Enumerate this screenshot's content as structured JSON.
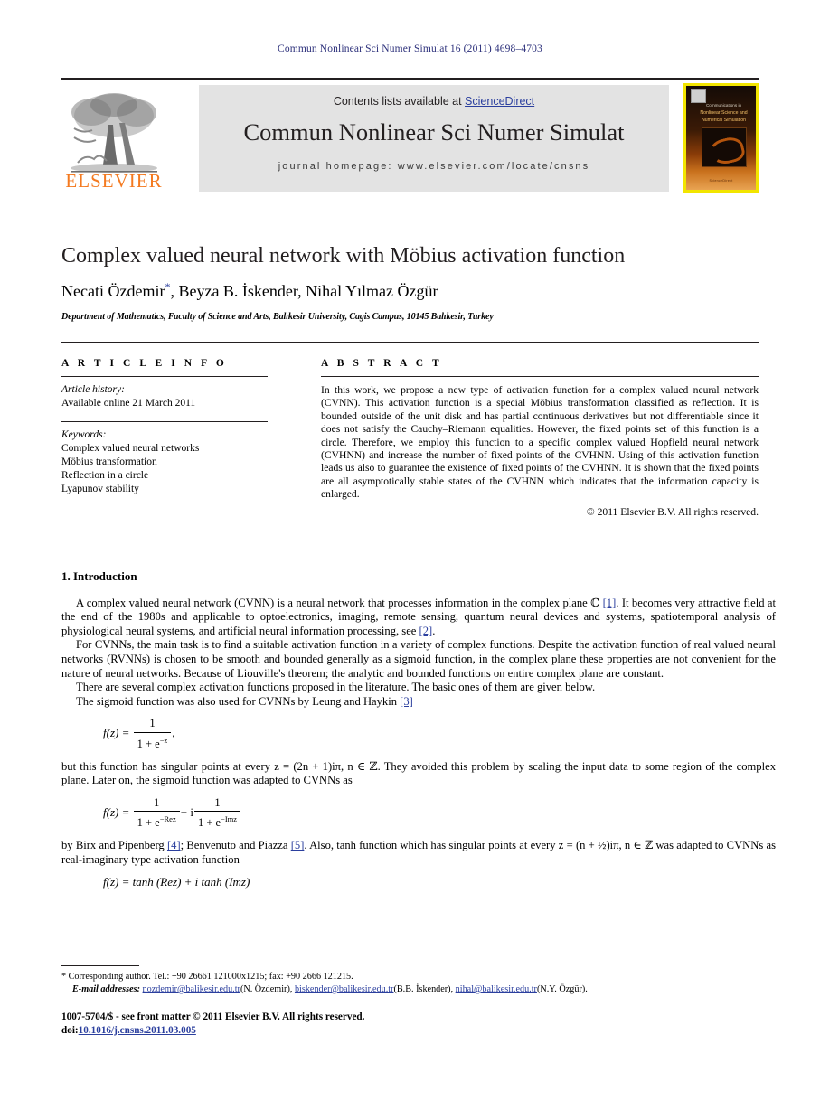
{
  "running_head": "Commun Nonlinear Sci Numer Simulat 16 (2011) 4698–4703",
  "masthead": {
    "contents_prefix": "Contents lists available at ",
    "sciencedirect": "ScienceDirect",
    "journal_name": "Commun Nonlinear Sci Numer Simulat",
    "homepage": "journal homepage: www.elsevier.com/locate/cnsns",
    "publisher_logo": "ELSEVIER",
    "cover": {
      "line1": "Communications in",
      "line2": "Nonlinear Science and",
      "line3": "Numerical Simulation",
      "footer": "ScienceDirect"
    }
  },
  "article": {
    "title": "Complex valued neural network with Möbius activation function",
    "authors": "Necati Özdemir",
    "corresponding_mark": "*",
    "authors_rest": ", Beyza B. İskender, Nihal Yılmaz Özgür",
    "affiliation": "Department of Mathematics, Faculty of Science and Arts, Balıkesir University, Cagis Campus, 10145 Balıkesir, Turkey"
  },
  "info": {
    "heading": "A R T I C L E   I N F O",
    "history_label": "Article history:",
    "history_value": "Available online 21 March 2011",
    "keywords_label": "Keywords:",
    "keywords": [
      "Complex valued neural networks",
      "Möbius transformation",
      "Reflection in a circle",
      "Lyapunov stability"
    ]
  },
  "abstract": {
    "heading": "A B S T R A C T",
    "text": "In this work, we propose a new type of activation function for a complex valued neural network (CVNN). This activation function is a special Möbius transformation classified as reflection. It is bounded outside of the unit disk and has partial continuous derivatives but not differentiable since it does not satisfy the Cauchy–Riemann equalities. However, the fixed points set of this function is a circle. Therefore, we employ this function to a specific complex valued Hopfield neural network (CVHNN) and increase the number of fixed points of the CVHNN. Using of this activation function leads us also to guarantee the existence of fixed points of the CVHNN. It is shown that the fixed points are all asymptotically stable states of the CVHNN which indicates that the information capacity is enlarged.",
    "copyright": "© 2011 Elsevier B.V. All rights reserved."
  },
  "body": {
    "section_heading": "1. Introduction",
    "p1_a": "A complex valued neural network (CVNN) is a neural network that processes information in the complex plane ℂ ",
    "p1_ref1": "[1]",
    "p1_b": ". It becomes very attractive field at the end of the 1980s and applicable to optoelectronics, imaging, remote sensing, quantum neural devices and systems, spatiotemporal analysis of physiological neural systems, and artificial neural information processing, see ",
    "p1_ref2": "[2]",
    "p1_c": ".",
    "p2": "For CVNNs, the main task is to find a suitable activation function in a variety of complex functions. Despite the activation function of real valued neural networks (RVNNs) is chosen to be smooth and bounded generally as a sigmoid function, in the complex plane these properties are not convenient for the nature of neural networks. Because of Liouville's theorem; the analytic and bounded functions on entire complex plane are constant.",
    "p3": "There are several complex activation functions proposed in the literature. The basic ones of them are given below.",
    "p4_a": "The sigmoid function was also used for CVNNs by Leung and Haykin ",
    "p4_ref": "[3]",
    "eq1": {
      "lhs": "f(z) =",
      "num": "1",
      "den_a": "1 + e",
      "den_exp": "−z",
      "tail": ","
    },
    "p5": "but this function has singular points at every z = (2n + 1)iπ,  n ∈ ℤ. They avoided this problem by scaling the input data to some region of the complex plane. Later on, the sigmoid function was adapted to CVNNs as",
    "eq2": {
      "lhs": "f(z) =",
      "num1": "1",
      "den1_a": "1 + e",
      "den1_exp": "−Rez",
      "plus": "+ i",
      "num2": "1",
      "den2_a": "1 + e",
      "den2_exp": "−Imz"
    },
    "p6_a": "by Birx and Pipenberg ",
    "p6_ref1": "[4]",
    "p6_b": "; Benvenuto and Piazza ",
    "p6_ref2": "[5]",
    "p6_c": ". Also, tanh function which has singular points at every z = (n + ½)iπ,  n ∈ ℤ was adapted to CVNNs as real-imaginary type activation function",
    "eq3": "f(z) = tanh (Rez) + i tanh (Imz)"
  },
  "footnotes": {
    "corresponding_mark": "*",
    "corresponding": "Corresponding author. Tel.: +90 26661 121000x1215; fax: +90 2666 121215.",
    "email_label": "E-mail addresses:",
    "emails": [
      {
        "address": "nozdemir@balikesir.edu.tr",
        "person": "(N. Özdemir)"
      },
      {
        "address": "biskender@balikesir.edu.tr",
        "person": "(B.B. İskender)"
      },
      {
        "address": "nihal@balikesir.edu.tr",
        "person": "(N.Y. Özgür)"
      }
    ]
  },
  "colophon": {
    "issn_line": "1007-5704/$ - see front matter © 2011 Elsevier B.V. All rights reserved.",
    "doi_label": "doi:",
    "doi_value": "10.1016/j.cnsns.2011.03.005"
  },
  "colors": {
    "link": "#2b3f9e",
    "runhead": "#2b2f7a",
    "elsevier_orange": "#f47a20",
    "band_gray": "#e3e3e3",
    "cover_yellow": "#f2e500"
  }
}
